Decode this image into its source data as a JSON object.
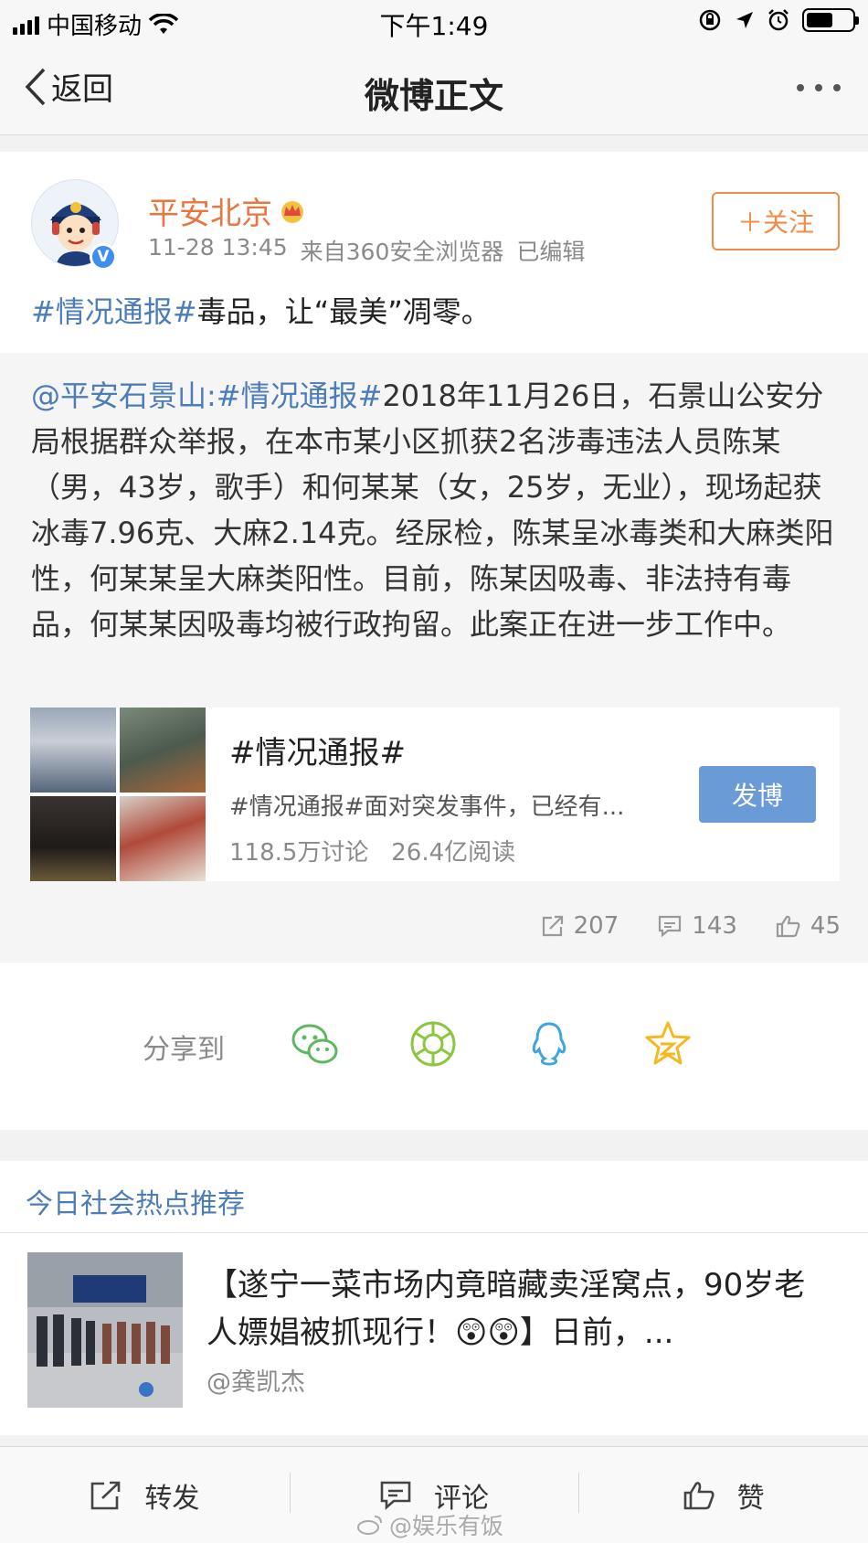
{
  "status_bar": {
    "carrier": "中国移动",
    "time": "下午1:49"
  },
  "nav": {
    "back_label": "返回",
    "title": "微博正文"
  },
  "post": {
    "username": "平安北京",
    "timestamp": "11-28 13:45",
    "source": "来自360安全浏览器",
    "edited": "已编辑",
    "follow_label": "＋关注",
    "topic": "#情况通报#",
    "text": "毒品，让“最美”凋零。"
  },
  "repost": {
    "mention": "@平安石景山",
    "colon": ":",
    "topic": "#情况通报#",
    "text": "2018年11月26日，石景山公安分局根据群众举报，在本市某小区抓获2名涉毒违法人员陈某（男，43岁，歌手）和何某某（女，25岁，无业），现场起获冰毒7.96克、大麻2.14克。经尿检，陈某呈冰毒类和大麻类阳性，何某某呈大麻类阳性。目前，陈某因吸毒、非法持有毒品，何某某因吸毒均被行政拘留。此案正在进一步工作中。",
    "card": {
      "title": "#情况通报#",
      "desc": "#情况通报#面对突发事件，已经有...",
      "discussions": "118.5万讨论",
      "reads": "26.4亿阅读",
      "button_label": "发博"
    },
    "reposts": "207",
    "comments": "143",
    "likes": "45"
  },
  "share": {
    "label": "分享到",
    "targets": [
      "wechat-icon",
      "moments-icon",
      "qq-icon",
      "qzone-icon"
    ]
  },
  "hot": {
    "header": "今日社会热点推荐",
    "title": "【遂宁一菜市场内竟暗藏卖淫窝点，90岁老人嫖娼被抓现行！😲😲】日前，...",
    "author": "@龚凯杰"
  },
  "tabbar": {
    "repost_label": "转发",
    "comment_label": "评论",
    "like_label": "赞"
  },
  "watermark": "@娱乐有饭",
  "colors": {
    "link": "#4c7db8",
    "orange": "#e8763e",
    "button_blue": "#6b9bd6"
  }
}
